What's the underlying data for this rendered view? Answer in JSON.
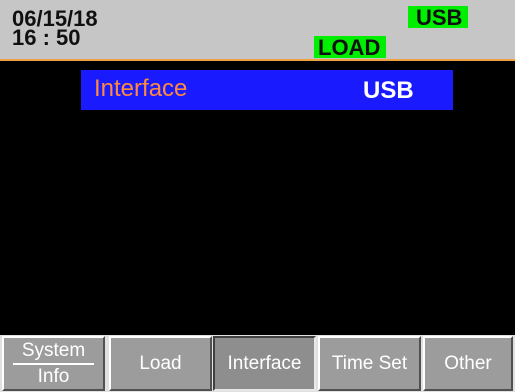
{
  "status_bar": {
    "date": "06/15/18",
    "time": "16 : 50",
    "interface_indicator": "USB",
    "mode_indicator": "LOAD",
    "indicator_color": "#00ee00"
  },
  "main": {
    "interface_setting": {
      "label": "Interface",
      "value": "USB",
      "label_color": "#ff8a3c",
      "highlight_color": "#1a1aff"
    }
  },
  "softkeys": [
    {
      "top": "System",
      "bottom": "Info"
    },
    {
      "label": "Load"
    },
    {
      "label": "Interface",
      "selected": true
    },
    {
      "label": "Time Set"
    },
    {
      "label": "Other"
    }
  ]
}
